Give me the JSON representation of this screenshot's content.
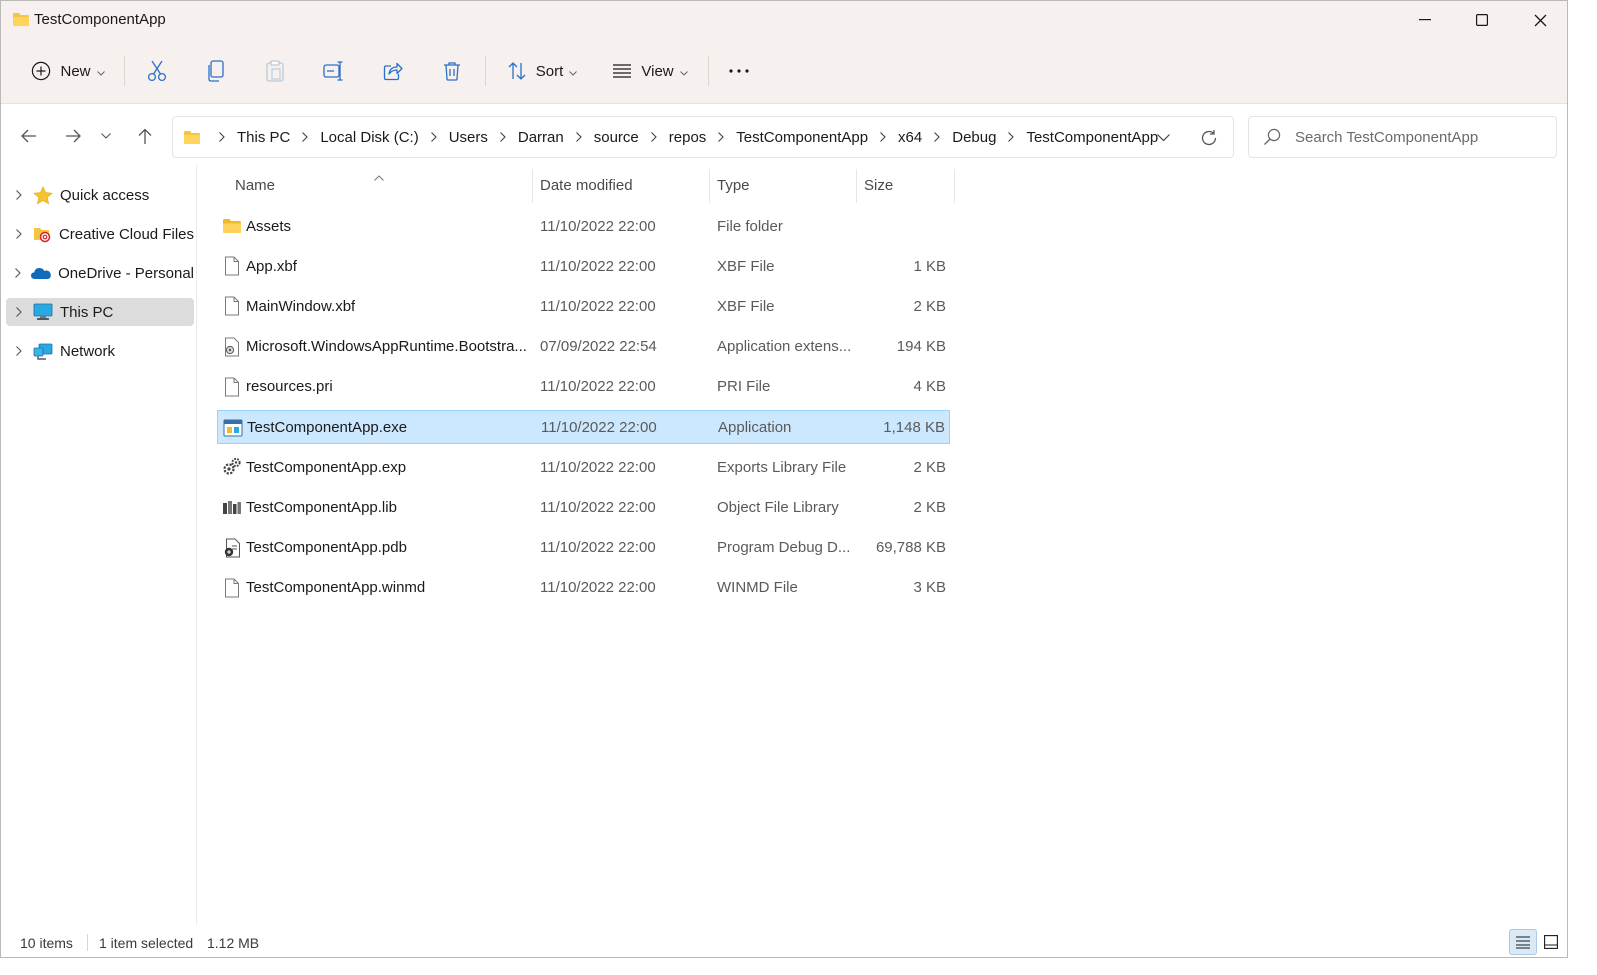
{
  "window": {
    "title": "TestComponentApp"
  },
  "toolbar": {
    "new_label": "New",
    "sort_label": "Sort",
    "view_label": "View",
    "icons": [
      "plus-circle-icon",
      "cut-icon",
      "copy-icon",
      "paste-icon",
      "rename-icon",
      "share-icon",
      "delete-icon",
      "sort-icon",
      "view-icon",
      "more-icon"
    ]
  },
  "address": {
    "crumbs": [
      "This PC",
      "Local Disk (C:)",
      "Users",
      "Darran",
      "source",
      "repos",
      "TestComponentApp",
      "x64",
      "Debug",
      "TestComponentApp"
    ]
  },
  "search": {
    "placeholder": "Search TestComponentApp"
  },
  "sidebar": {
    "items": [
      {
        "label": "Quick access",
        "icon": "star-icon"
      },
      {
        "label": "Creative Cloud Files",
        "icon": "creative-cloud-icon"
      },
      {
        "label": "OneDrive - Personal",
        "icon": "cloud-icon"
      },
      {
        "label": "This PC",
        "icon": "computer-icon",
        "selected": true
      },
      {
        "label": "Network",
        "icon": "network-icon"
      }
    ]
  },
  "columns": {
    "name": "Name",
    "date": "Date modified",
    "type": "Type",
    "size": "Size"
  },
  "files": [
    {
      "name": "Assets",
      "date": "11/10/2022 22:00",
      "type": "File folder",
      "size": "",
      "icon": "folder-icon"
    },
    {
      "name": "App.xbf",
      "date": "11/10/2022 22:00",
      "type": "XBF File",
      "size": "1 KB",
      "icon": "file-icon"
    },
    {
      "name": "MainWindow.xbf",
      "date": "11/10/2022 22:00",
      "type": "XBF File",
      "size": "2 KB",
      "icon": "file-icon"
    },
    {
      "name": "Microsoft.WindowsAppRuntime.Bootstra...",
      "date": "07/09/2022 22:54",
      "type": "Application extens...",
      "size": "194 KB",
      "icon": "dll-icon"
    },
    {
      "name": "resources.pri",
      "date": "11/10/2022 22:00",
      "type": "PRI File",
      "size": "4 KB",
      "icon": "file-icon"
    },
    {
      "name": "TestComponentApp.exe",
      "date": "11/10/2022 22:00",
      "type": "Application",
      "size": "1,148 KB",
      "icon": "exe-icon",
      "selected": true
    },
    {
      "name": "TestComponentApp.exp",
      "date": "11/10/2022 22:00",
      "type": "Exports Library File",
      "size": "2 KB",
      "icon": "gears-icon"
    },
    {
      "name": "TestComponentApp.lib",
      "date": "11/10/2022 22:00",
      "type": "Object File Library",
      "size": "2 KB",
      "icon": "library-icon"
    },
    {
      "name": "TestComponentApp.pdb",
      "date": "11/10/2022 22:00",
      "type": "Program Debug D...",
      "size": "69,788 KB",
      "icon": "debug-file-icon"
    },
    {
      "name": "TestComponentApp.winmd",
      "date": "11/10/2022 22:00",
      "type": "WINMD File",
      "size": "3 KB",
      "icon": "file-icon"
    }
  ],
  "status": {
    "items": "10 items",
    "selected": "1 item selected",
    "size": "1.12 MB"
  },
  "colors": {
    "selection": "#cce8ff",
    "selection_border": "#99d1ff",
    "chrome": "#f6f1ee",
    "folder": "#f4c443"
  }
}
